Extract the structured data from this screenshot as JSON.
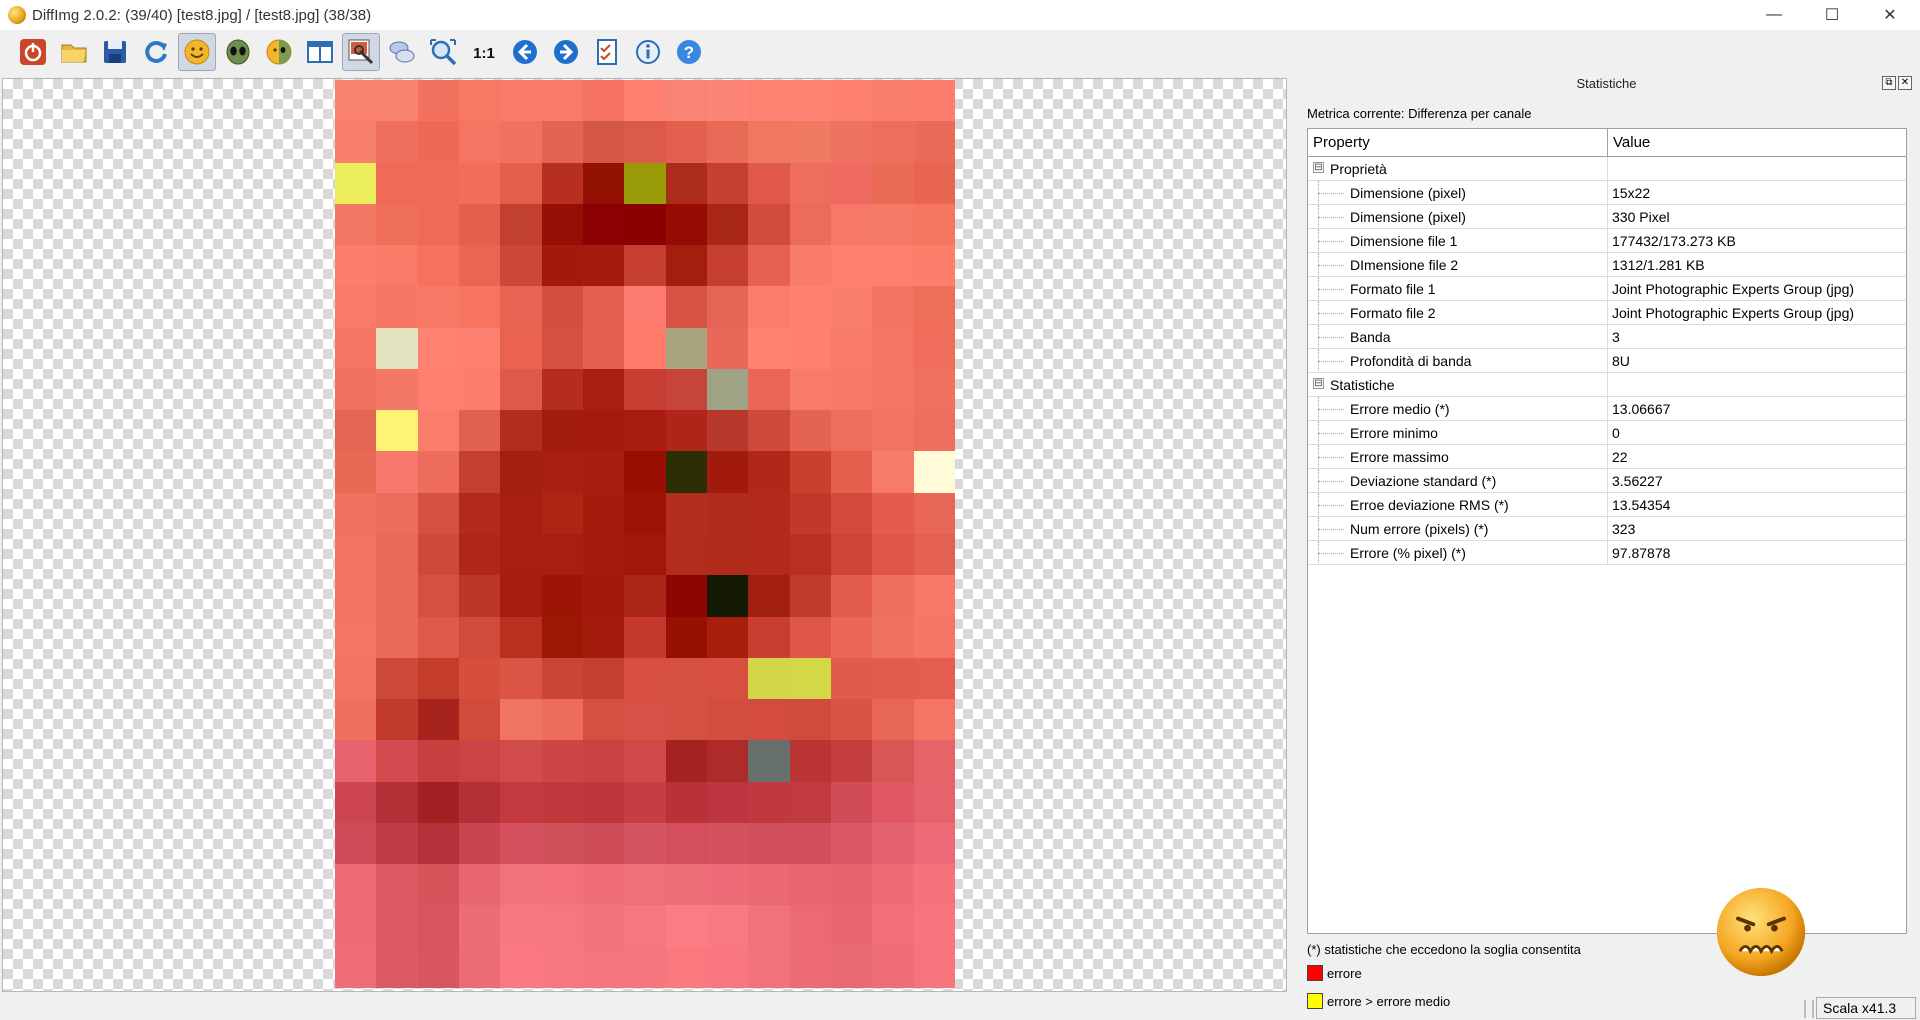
{
  "window": {
    "title": "DiffImg 2.0.2:  (39/40) [test8.jpg] / [test8.jpg] (38/38)",
    "minimize_glyph": "—",
    "maximize_glyph": "☐",
    "close_glyph": "✕"
  },
  "toolbar": {
    "buttons": [
      {
        "name": "exit-icon",
        "active": false
      },
      {
        "name": "open-folder-icon",
        "active": false
      },
      {
        "name": "save-icon",
        "active": false
      },
      {
        "name": "refresh-icon",
        "active": false
      },
      {
        "name": "smiley-icon",
        "active": true
      },
      {
        "name": "alien-icon",
        "active": false
      },
      {
        "name": "half-face-icon",
        "active": false
      },
      {
        "name": "split-view-icon",
        "active": false
      },
      {
        "name": "image-tool-icon",
        "active": true
      },
      {
        "name": "compare-icon",
        "active": false
      },
      {
        "name": "zoom-fit-icon",
        "active": false
      },
      {
        "name": "zoom-1-1-icon",
        "active": false
      },
      {
        "name": "arrow-left-icon",
        "active": false
      },
      {
        "name": "arrow-right-icon",
        "active": false
      },
      {
        "name": "checklist-icon",
        "active": false
      },
      {
        "name": "info-icon",
        "active": false
      },
      {
        "name": "help-icon",
        "active": false
      }
    ],
    "zoom_label": "1:1"
  },
  "image": {
    "columns": 15,
    "rows": 22,
    "pixels": [
      [
        "#f98370",
        "#fa8370",
        "#f2715f",
        "#f67964",
        "#fa7b69",
        "#f87a68",
        "#f67363",
        "#fe7f70",
        "#f88476",
        "#fc8575",
        "#fd8272",
        "#fd8373",
        "#fc7f70",
        "#fb7f6e",
        "#fb7f6c"
      ],
      [
        "#f9806d",
        "#f0705f",
        "#ee6a57",
        "#f57562",
        "#f2715f",
        "#e16552",
        "#d55847",
        "#db5a4b",
        "#e55f4e",
        "#e86b57",
        "#f07861",
        "#f17a63",
        "#ee735f",
        "#ed6e5b",
        "#eb6b59"
      ],
      [
        "#ebee5a",
        "#ef6b56",
        "#ee6c57",
        "#f06e5a",
        "#e25f4b",
        "#b62f1f",
        "#931203",
        "#999a08",
        "#ac2c1b",
        "#c6402f",
        "#e0584b",
        "#ef6d5e",
        "#ef6a5e",
        "#ea6a56",
        "#e86551"
      ],
      [
        "#f37864",
        "#f06f5a",
        "#ef6b56",
        "#e4604d",
        "#c2402f",
        "#960f05",
        "#8a0003",
        "#8a0000",
        "#960b04",
        "#a82615",
        "#d14c3e",
        "#ed6b5d",
        "#f67968",
        "#f57a66",
        "#f67761"
      ],
      [
        "#fb7f6c",
        "#f87b67",
        "#f7715f",
        "#eb6650",
        "#cb4838",
        "#a21a0c",
        "#a51b0f",
        "#c63d32",
        "#a31e0d",
        "#c53e2e",
        "#e66152",
        "#f87b6c",
        "#fd806e",
        "#fd806d",
        "#fc7f6b"
      ],
      [
        "#f87b68",
        "#f87764",
        "#f87866",
        "#f67460",
        "#e86452",
        "#d34e40",
        "#e36051",
        "#fe7c70",
        "#d65346",
        "#e46554",
        "#fa7c6b",
        "#fd8070",
        "#f97f6b",
        "#f37561",
        "#ee6e5a"
      ],
      [
        "#f47562",
        "#e2e2c0",
        "#fe8171",
        "#fe8070",
        "#e9634f",
        "#d55043",
        "#e35f50",
        "#fe7b6c",
        "#aaa57e",
        "#e9685a",
        "#fe8171",
        "#fe806f",
        "#f87c69",
        "#f27662",
        "#ef6d5a"
      ],
      [
        "#f0715e",
        "#f47866",
        "#fe7f70",
        "#fd7e6d",
        "#de5947",
        "#b42d20",
        "#a91e13",
        "#c53e31",
        "#c6443a",
        "#9ea385",
        "#ea6556",
        "#f77a6a",
        "#f87966",
        "#f57563",
        "#f2715e"
      ],
      [
        "#e36653",
        "#fff473",
        "#fa7c6b",
        "#e16050",
        "#b32d1d",
        "#a21c0d",
        "#a41a0c",
        "#a81c12",
        "#b02419",
        "#b8392b",
        "#ce4a3a",
        "#e56352",
        "#ed6e5a",
        "#f07461",
        "#ee6f5e"
      ],
      [
        "#e86a55",
        "#f8796b",
        "#ee6c5d",
        "#c3402f",
        "#a51f11",
        "#a8200f",
        "#a71d0f",
        "#970e03",
        "#2c2f05",
        "#a21a0c",
        "#b12818",
        "#ca3f2e",
        "#e4604d",
        "#f77b69",
        "#fffbd8"
      ],
      [
        "#f17261",
        "#ed6c5c",
        "#d4503f",
        "#b12a1b",
        "#a81f12",
        "#b02414",
        "#a51c0d",
        "#9f1304",
        "#b42e1d",
        "#b12b1b",
        "#b3291a",
        "#c2392a",
        "#d54b3b",
        "#e35c4c",
        "#e96758"
      ],
      [
        "#f37462",
        "#e96a5a",
        "#cd4a3a",
        "#ae271a",
        "#a71f10",
        "#a81f12",
        "#a41c0d",
        "#a11809",
        "#b02c1c",
        "#b12b1b",
        "#b22a1a",
        "#b93020",
        "#cd4535",
        "#de5646",
        "#e36052"
      ],
      [
        "#f27461",
        "#e96b59",
        "#d4513f",
        "#bc3726",
        "#a41d0f",
        "#9d1605",
        "#a21a0a",
        "#ab2519",
        "#8e0601",
        "#141a03",
        "#a31f0f",
        "#c13b2b",
        "#e35d4d",
        "#ef6f5f",
        "#f57868"
      ],
      [
        "#f37563",
        "#e86a58",
        "#dd5948",
        "#cf4b3a",
        "#b9301f",
        "#9d1705",
        "#a41d0c",
        "#c4392b",
        "#971004",
        "#a71e0d",
        "#c83e2f",
        "#de5646",
        "#ea6656",
        "#f07260",
        "#f47665"
      ],
      [
        "#f27361",
        "#cc4a37",
        "#c43d2a",
        "#d64e3c",
        "#db5544",
        "#cb4536",
        "#c54033",
        "#d74f40",
        "#d75143",
        "#d64f41",
        "#d3d64b",
        "#d3d847",
        "#e15b4c",
        "#e25c4d",
        "#e35e4e"
      ],
      [
        "#ef705f",
        "#c13a2e",
        "#a6241b",
        "#d04b3b",
        "#f07463",
        "#ec6d5e",
        "#d55043",
        "#d75146",
        "#d65144",
        "#d24c40",
        "#d34c3f",
        "#d14a3e",
        "#d95347",
        "#e86657",
        "#f57464"
      ],
      [
        "#e8626d",
        "#d14b4f",
        "#c6403f",
        "#ca4446",
        "#d24c4b",
        "#cd4646",
        "#c94242",
        "#d04948",
        "#a52222",
        "#ae2b2a",
        "#67706a",
        "#b93432",
        "#c53e3e",
        "#d95657",
        "#e66467"
      ],
      [
        "#cc4550",
        "#b33136",
        "#a52023",
        "#b43036",
        "#c23a40",
        "#c0373c",
        "#be363b",
        "#c63e43",
        "#ba3238",
        "#bd3540",
        "#c0393e",
        "#c03a40",
        "#d04b55",
        "#df5864",
        "#e8626b"
      ],
      [
        "#d04c59",
        "#bf3c45",
        "#b3323a",
        "#c9444e",
        "#d3505c",
        "#d0505a",
        "#cd4b55",
        "#d55461",
        "#d44f5b",
        "#d4525d",
        "#d04e59",
        "#d24e5a",
        "#dc5866",
        "#e46270",
        "#ec6a76"
      ],
      [
        "#eb6a73",
        "#dd5b62",
        "#d8545b",
        "#e76670",
        "#f3737c",
        "#f2717a",
        "#ee6d76",
        "#f0707a",
        "#ee6e78",
        "#ee6c77",
        "#ea6973",
        "#e8666f",
        "#e8656d",
        "#ee6c75",
        "#f5737b"
      ],
      [
        "#ee6c74",
        "#de5a62",
        "#da545d",
        "#ed6d75",
        "#f87880",
        "#f67780",
        "#f3737c",
        "#f7777f",
        "#fc7c84",
        "#f97a82",
        "#f1727b",
        "#ec6a73",
        "#e96770",
        "#f16f78",
        "#f7767e"
      ],
      [
        "#f06e75",
        "#dc5b62",
        "#d8575f",
        "#ec6c73",
        "#fb7a82",
        "#f8787f",
        "#f5757d",
        "#f6767e",
        "#f9797f",
        "#f9787f",
        "#f2737a",
        "#ed6c74",
        "#ea6a72",
        "#f06f77",
        "#f6757d"
      ]
    ]
  },
  "panel": {
    "title": "Statistiche",
    "float_glyph": "⧉",
    "close_glyph": "✕",
    "metric_label": "Metrica corrente: Differenza per canale",
    "columns": [
      "Property",
      "Value"
    ],
    "groups": [
      {
        "name": "Proprietà",
        "expander": "⊟",
        "rows": [
          {
            "property": "Dimensione (pixel)",
            "value": "15x22"
          },
          {
            "property": "Dimensione (pixel)",
            "value": "330 Pixel"
          },
          {
            "property": "Dimensione file 1",
            "value": "177432/173.273 KB"
          },
          {
            "property": "DImensione file 2",
            "value": "1312/1.281 KB"
          },
          {
            "property": "Formato file 1",
            "value": "Joint Photographic Experts Group (jpg)"
          },
          {
            "property": "Formato file 2",
            "value": "Joint Photographic Experts Group (jpg)"
          },
          {
            "property": "Banda",
            "value": "3"
          },
          {
            "property": "Profondità di banda",
            "value": "8U"
          }
        ]
      },
      {
        "name": "Statistiche",
        "expander": "⊟",
        "rows": [
          {
            "property": "Errore medio (*)",
            "value": "13.06667"
          },
          {
            "property": "Errore minimo",
            "value": "0"
          },
          {
            "property": "Errore massimo",
            "value": "22"
          },
          {
            "property": "Deviazione standard (*)",
            "value": "3.56227"
          },
          {
            "property": "Erroe deviazione RMS (*)",
            "value": "13.54354"
          },
          {
            "property": "Num errore (pixels) (*)",
            "value": "323"
          },
          {
            "property": "Errore (% pixel) (*)",
            "value": "97.87878"
          }
        ]
      }
    ],
    "note": "(*) statistiche che eccedono la soglia consentita",
    "legend": [
      {
        "label": "errore",
        "color": "#ff0000"
      },
      {
        "label": "errore > errore medio",
        "color": "#ffff00"
      }
    ],
    "status_face": "angry-face-icon"
  },
  "statusbar": {
    "scale": "Scala x41.3"
  }
}
